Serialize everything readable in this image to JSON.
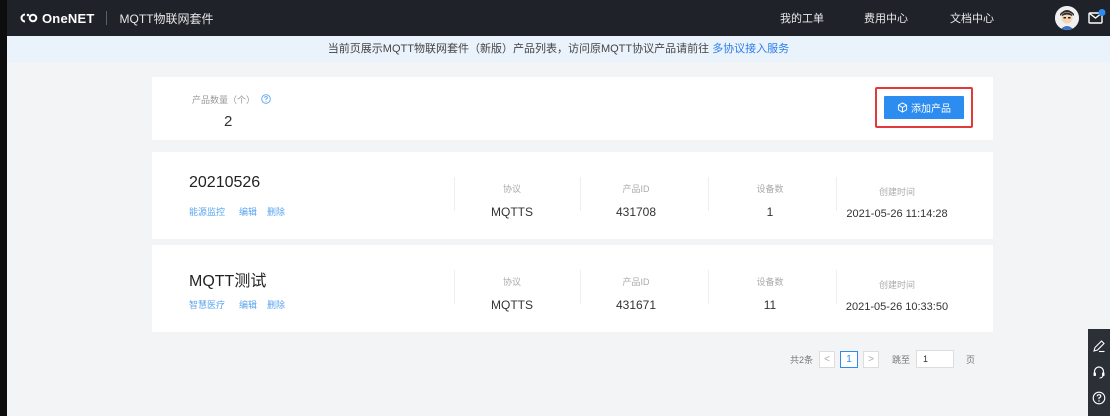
{
  "header": {
    "logo_text": "OneNET",
    "app_title": "MQTT物联网套件",
    "links": [
      "我的工单",
      "费用中心",
      "文档中心"
    ]
  },
  "notice": {
    "text": "当前页展示MQTT物联网套件（新版）产品列表，访问原MQTT协议产品请前往",
    "link": "多协议接入服务"
  },
  "summary": {
    "label": "产品数量（个）",
    "count": "2",
    "add_button": "添加产品"
  },
  "columns": {
    "protocol": "协议",
    "product_id": "产品ID",
    "device_count": "设备数",
    "created": "创建时间"
  },
  "products": [
    {
      "name": "20210526",
      "tag": "能源监控",
      "edit": "编辑",
      "delete": "删除",
      "protocol": "MQTTS",
      "product_id": "431708",
      "device_count": "1",
      "created": "2021-05-26 11:14:28"
    },
    {
      "name": "MQTT测试",
      "tag": "智慧医疗",
      "edit": "编辑",
      "delete": "删除",
      "protocol": "MQTTS",
      "product_id": "431671",
      "device_count": "11",
      "created": "2021-05-26 10:33:50"
    }
  ],
  "pagination": {
    "total": "共2条",
    "prev": "<",
    "current": "1",
    "next": ">",
    "jump_label": "跳至",
    "jump_value": "1",
    "page_unit": "页"
  },
  "icons": {
    "float": [
      "edit-pen-icon",
      "headset-icon",
      "help-icon"
    ]
  },
  "colors": {
    "primary": "#2d8cf0",
    "highlight": "#e23a3a",
    "header_bg": "#1f2229",
    "notice_bg": "#eaf3fc"
  }
}
